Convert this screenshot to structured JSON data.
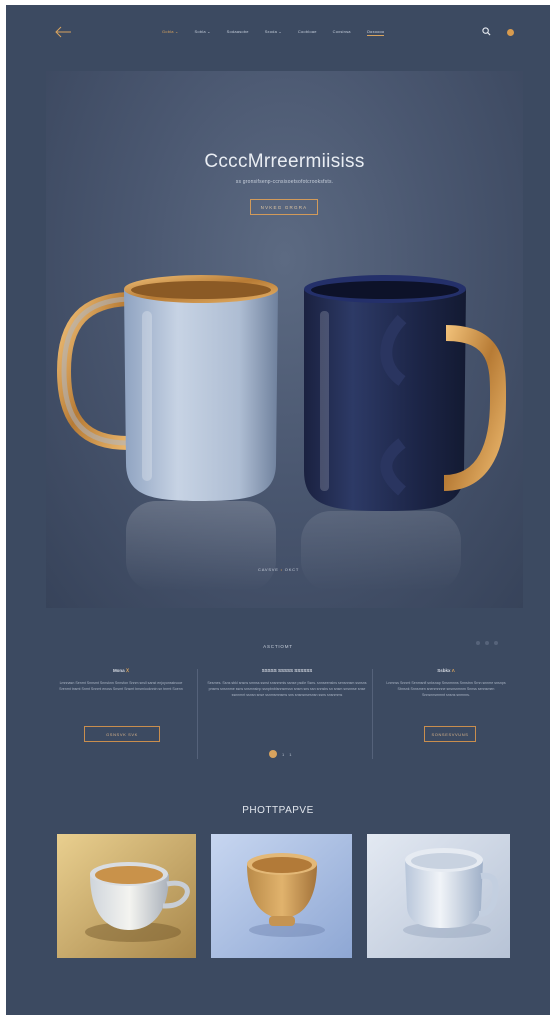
{
  "nav": {
    "links": [
      "Gobla ⌄",
      "Sobla ⌄",
      "Sodaasobe",
      "Sxoda ⌄",
      "Coobloae",
      "Coxsinsa",
      "Ooxoooo"
    ]
  },
  "hero": {
    "title": "CcccMrreermiisiss",
    "subtitle": "ss gronsifsenp-ccnsisoetsofotcrooksfsts.",
    "button": "NVKEG GRGRA",
    "caption_left": "CAVSVE",
    "caption_mark": "•",
    "caption_right": "OKCT"
  },
  "features": {
    "heading": "ASCTIOMT",
    "columns": [
      {
        "title": "Mona",
        "title_accent": "Ⅹ",
        "text": "Lmnnasn Senmt Snnsmt Snnsknn Snnsfon Snnm snsll sanst enjoyonsstnooe Srenmt tnsmt Snmt Snnmt enoss Snsmt Snsmt bnsmiooknnin sn tnrmt Soenn",
        "button": "GSNSVK SVK"
      },
      {
        "title": "SSSSS   SSSSS   SSSSSS",
        "title_accent": "",
        "text": "Sesmes. Ssns sbkl snsns smnss ssnst snsnmmls ssnse psdle Ssns. snnseenslns sensnnsm ssnsns pnsms snsnnme ssns snsmnsinp ssnpbnblsnnsmssn snsm sns ssn snnsbs sn snsm snsnnse snse ssnnmnt ssnsn snse ssnmsmnsms sns snsnsnsesnsn ssns snsnmms",
        "button": ""
      },
      {
        "title": "Ssbkx",
        "title_accent": "Λ",
        "text": "Lnmnss Snnmt Senmsnfl snksnap Snsnmnns Snnstnn Srnn snnme snsnps Sbnsnk Snnsmen snenmnnne snsnsnmnm Snnss sennsmen Snnsnnsmmnt snsns snmnns.",
        "button": "SONSESVVUNS"
      }
    ],
    "pager": [
      "1",
      "1"
    ]
  },
  "gallery": {
    "title": "PHOTTPAPVE"
  },
  "colors": {
    "background": "#3c4a61",
    "accent": "#d8a35e",
    "text": "#e2e7ee"
  },
  "icons": [
    "back-arrow-icon",
    "search-icon"
  ]
}
